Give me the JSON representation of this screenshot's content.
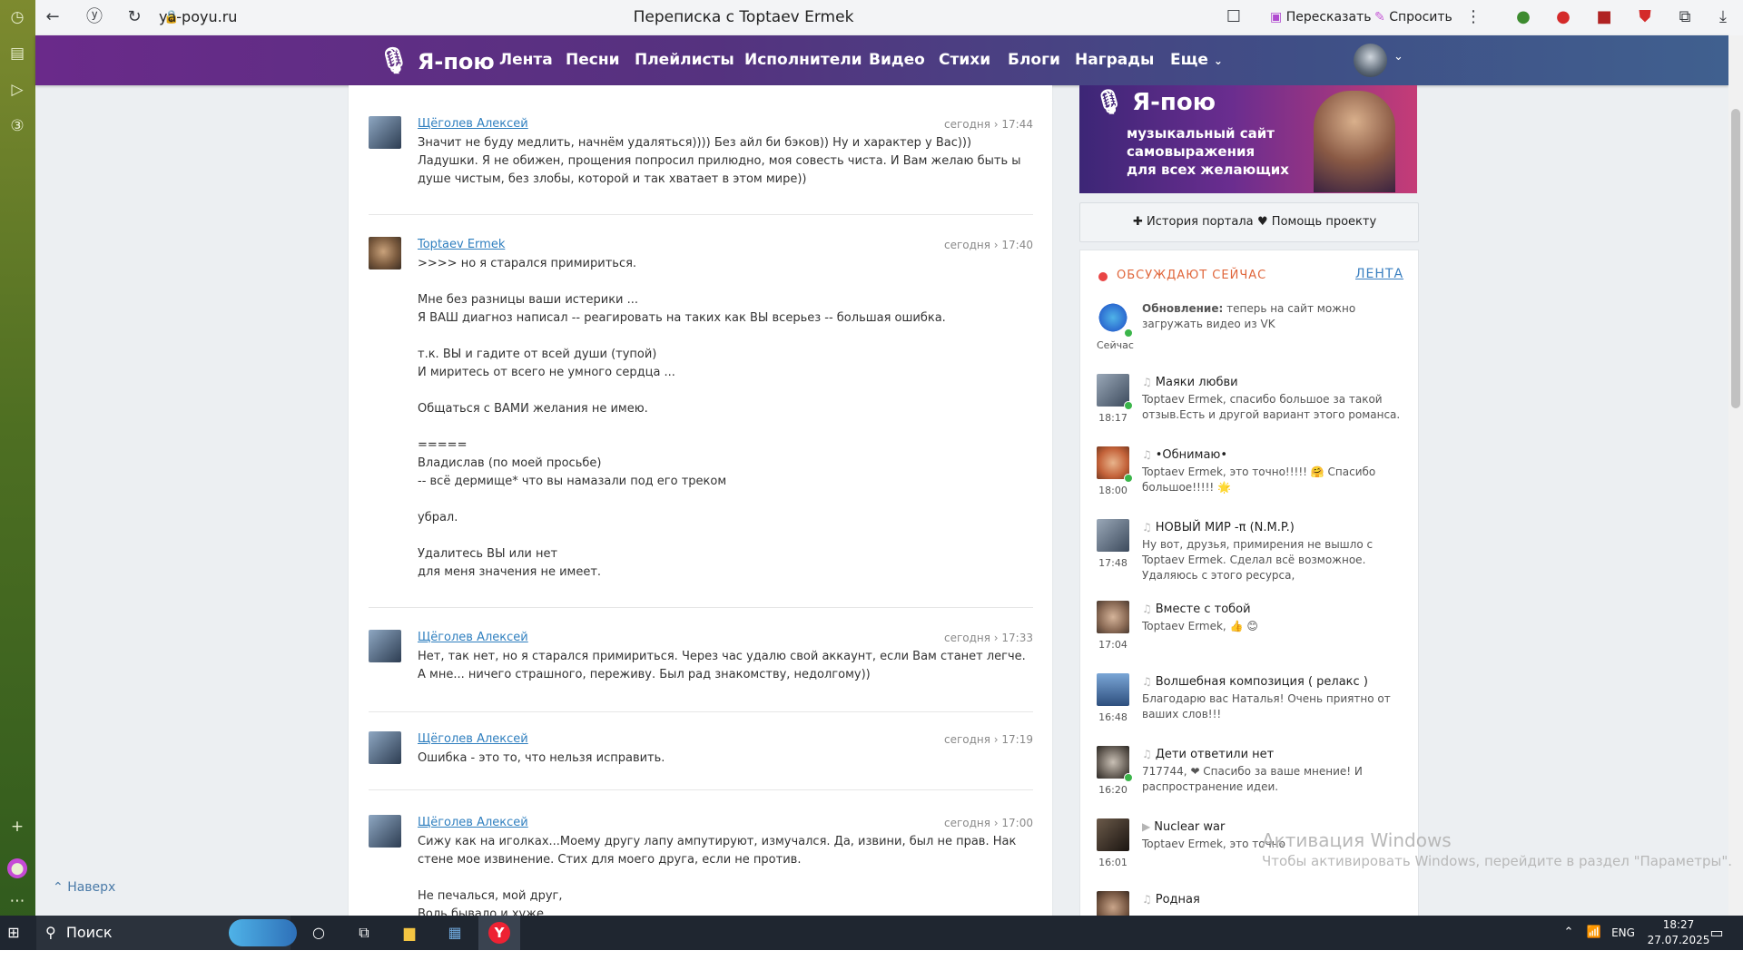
{
  "browser": {
    "url": "ya-poyu.ru",
    "title": "Переписка с Toptaev Ermek",
    "retell_label": "Пересказать",
    "ask_label": "Спросить"
  },
  "site": {
    "logo": "Я-пою",
    "nav": [
      "Лента",
      "Песни",
      "Плейлисты",
      "Исполнители",
      "Видео",
      "Стихи",
      "Блоги",
      "Награды",
      "Еще"
    ]
  },
  "messages": [
    {
      "author": "Щёголев Алексей",
      "time": "сегодня › 17:44",
      "avatar": "a",
      "text": "Значит не буду медлить, начнём удаляться)))) Без айл би бэков)) Ну и характер у Вас))) Ладушки. Я не обижен, прощения попросил прилюдно, моя совесть чиста. И Вам желаю быть ы душе чистым, без злобы, которой и так хватает в этом мире))"
    },
    {
      "author": "Toptaev Ermek",
      "time": "сегодня › 17:40",
      "avatar": "tp",
      "text": ">>>> но я старался примириться.\n\nМне без разницы ваши истерики ...\nЯ ВАШ диагноз написал -- реагировать на таких как ВЫ всерьез -- большая ошибка.\n\nт.к. ВЫ и гадите от всей души (тупой)\nИ миритесь от всего не умного сердца ...\n\nОбщаться с ВАМИ желания не имею.\n\n=====\nВладислав (по моей просьбе)\n-- всё дермище* что вы намазали под его треком\n\nубрал.\n\nУдалитесь ВЫ или нет\nдля меня значения не имеет."
    },
    {
      "author": "Щёголев Алексей",
      "time": "сегодня › 17:33",
      "avatar": "a",
      "text": "Нет, так нет, но я старался примириться. Через час удалю свой аккаунт, если Вам станет легче. А мне... ничего страшного, переживу. Был рад знакомству, недолгому))"
    },
    {
      "author": "Щёголев Алексей",
      "time": "сегодня › 17:19",
      "avatar": "a",
      "text": "Ошибка - это то, что нельзя исправить."
    },
    {
      "author": "Щёголев Алексей",
      "time": "сегодня › 17:00",
      "avatar": "a",
      "text": "Сижу как на иголках...Моему другу лапу ампутируют, измучался. Да, извини, был не прав. Нак стене мое извинение. Стих для моего друга, если не против.\n\nНе печалься, мой друг,\nВоль бывало и хуже"
    }
  ],
  "banner": {
    "logo": "Я-пою",
    "tagline1": "музыкальный сайт",
    "tagline2": "самовыражения",
    "tagline3": "для всех желающих"
  },
  "links": {
    "history": "История портала",
    "help": "Помощь проекту"
  },
  "discuss": {
    "heading": "ОБСУЖДАЮТ СЕЙЧАС",
    "feed_link": "ЛЕНТА",
    "items": [
      {
        "time": "Сейчас",
        "title": "",
        "bold": "Обновление:",
        "text": "теперь на сайт можно загружать видео из VK"
      },
      {
        "time": "18:17",
        "title": "Маяки любви",
        "text": "Toptaev Ermek, спасибо большое за такой отзыв.Есть и другой вариант этого романса."
      },
      {
        "time": "18:00",
        "title": "•Обнимаю•",
        "text": "Toptaev Ermek, это точно!!!!! 🤗 Спасибо большое!!!!! 🌟"
      },
      {
        "time": "17:48",
        "title": "НОВЫЙ МИР -π (N.M.P.)",
        "text": "Ну вот, друзья, примирения не вышло с Toptaev Ermek. Сделал всё возможное. Удаляюсь с этого ресурса,"
      },
      {
        "time": "17:04",
        "title": "Вместе с тобой",
        "text": "Toptaev Ermek, 👍 😊"
      },
      {
        "time": "16:48",
        "title": "Волшебная композиция ( релакс )",
        "text": "Благодарю вас Наталья! Очень приятно от ваших слов!!!"
      },
      {
        "time": "16:20",
        "title": "Дети ответили нет",
        "text": "717744, ❤ Спасибо за ваше мнение! И распространение идеи."
      },
      {
        "time": "16:01",
        "title": "Nuclear war",
        "text": "Toptaev Ermek, это точно"
      },
      {
        "time": "",
        "title": "Родная",
        "text": ""
      }
    ]
  },
  "back_top": "Наверх",
  "watermark": {
    "line1": "Активация Windows",
    "line2": "Чтобы активировать Windows, перейдите в раздел \"Параметры\"."
  },
  "taskbar": {
    "search": "Поиск",
    "lang": "ENG",
    "time": "18:27",
    "date": "27.07.2025"
  }
}
